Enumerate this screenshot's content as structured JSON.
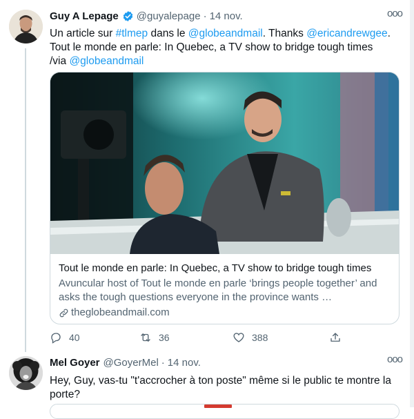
{
  "tweet1": {
    "name": "Guy A Lepage",
    "handle": "@guyalepage",
    "separator": "·",
    "date": "14 nov.",
    "more": "ooo",
    "text": {
      "p1": "Un article sur ",
      "hashtag": "#tlmep",
      "p2": " dans le ",
      "mention1": "@globeandmail",
      "p3": ". Thanks ",
      "mention2": "@ericandrewgee",
      "p4": ".",
      "line2": "Tout le monde en parle: In Quebec, a TV show to bridge tough times",
      "via": "/via ",
      "mention3": "@globeandmail"
    },
    "card": {
      "title": "Tout le monde en parle: In Quebec, a TV show to bridge tough times",
      "description": "Avuncular host of Tout le monde en parle ‘brings people together’ and asks the tough questions everyone in the province wants …",
      "domain": "theglobeandmail.com"
    },
    "actions": {
      "replies": "40",
      "retweets": "36",
      "likes": "388"
    }
  },
  "tweet2": {
    "name": "Mel Goyer",
    "handle": "@GoyerMel",
    "separator": "·",
    "date": "14 nov.",
    "more": "ooo",
    "text": "Hey, Guy, vas-tu \"t'accrocher à ton poste\" même si le public te montre la porte?"
  },
  "colors": {
    "link": "#1d9bf0",
    "muted": "#536471",
    "verified": "#1d9bf0",
    "border": "#cfd9de"
  }
}
